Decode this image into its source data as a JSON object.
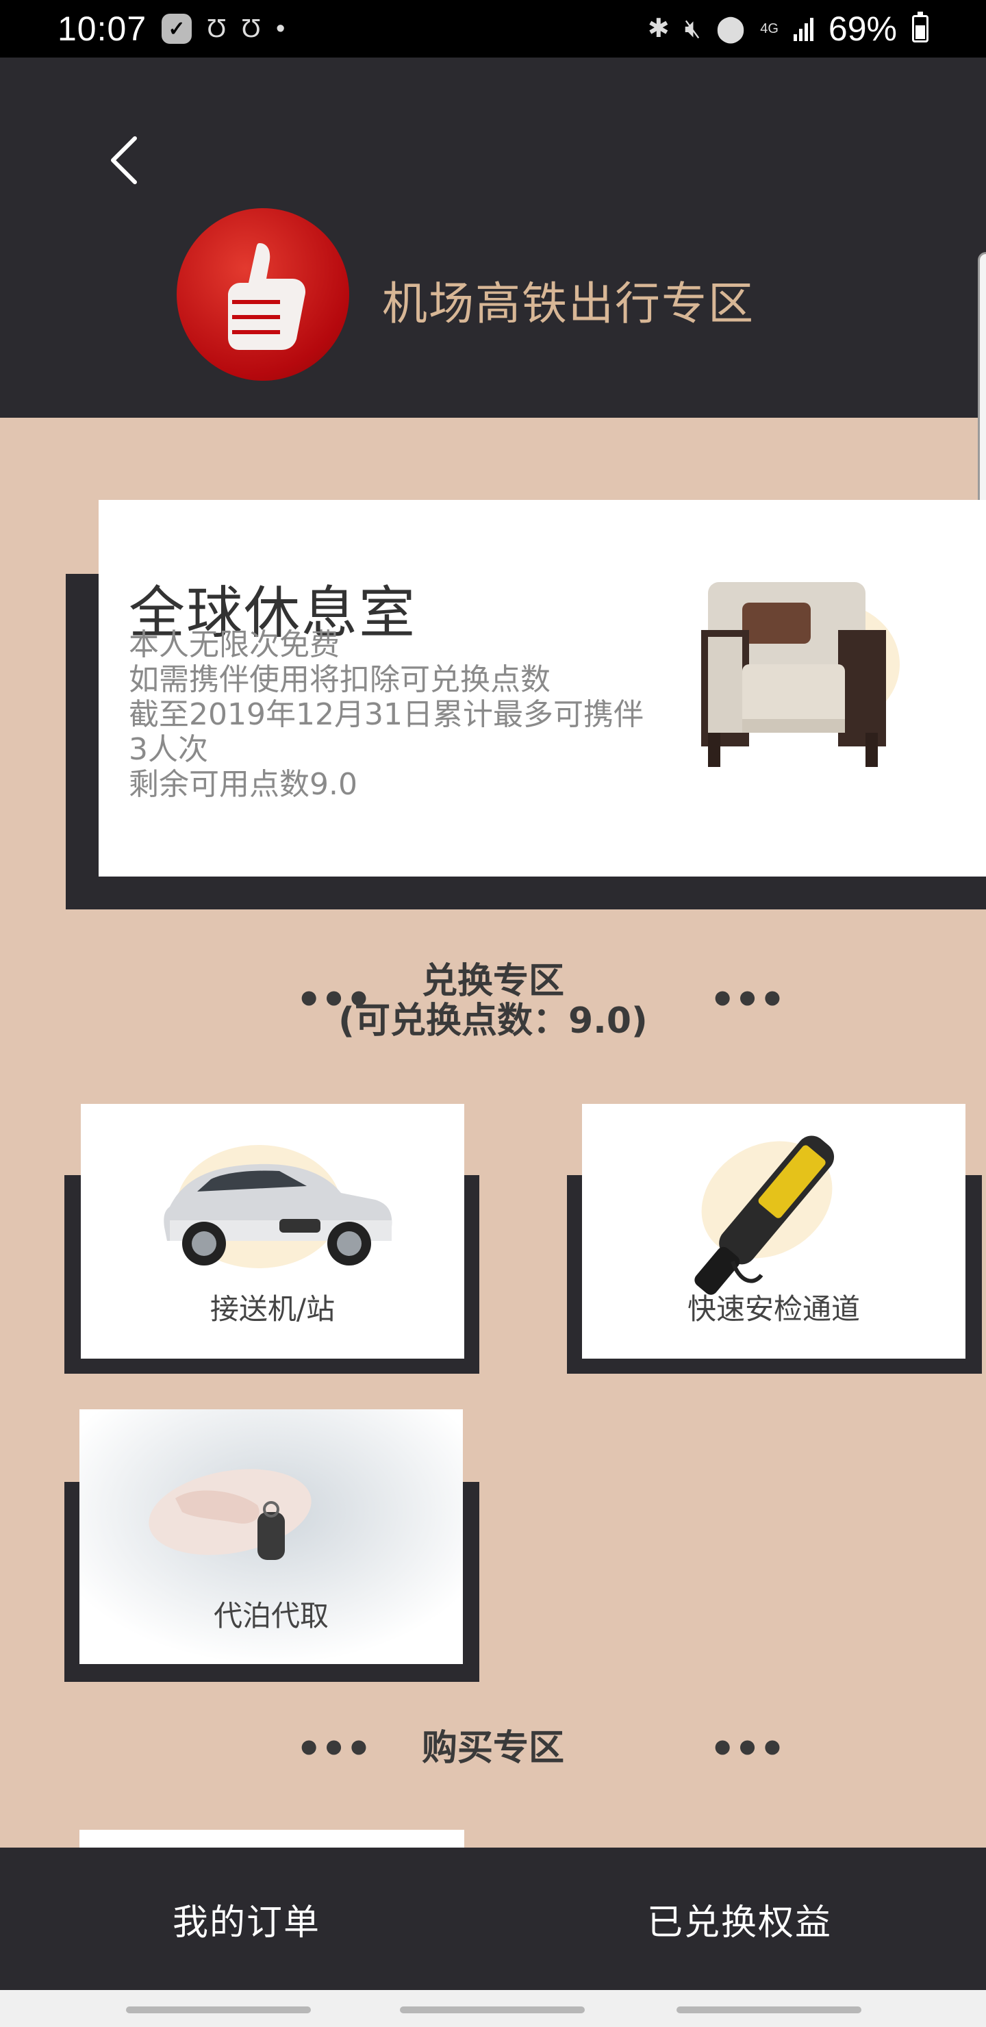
{
  "status_bar": {
    "time": "10:07",
    "battery": "69%",
    "network": "4G"
  },
  "header": {
    "title": "机场高铁出行专区"
  },
  "lounge": {
    "title": "全球休息室",
    "lines": [
      "本人无限次免费",
      "如需携伴使用将扣除可兑换点数",
      "截至2019年12月31日累计最多可携伴",
      "3人次",
      "剩余可用点数9.0"
    ]
  },
  "exchange_section": {
    "title_line1": "兑换专区",
    "title_line2": "(可兑换点数：9.0)",
    "tiles": [
      {
        "label": "接送机/站",
        "icon": "car-icon"
      },
      {
        "label": "快速安检通道",
        "icon": "metal-detector-icon"
      },
      {
        "label": "代泊代取",
        "icon": "car-key-icon"
      }
    ]
  },
  "purchase_section": {
    "title": "购买专区"
  },
  "bottom_nav": {
    "my_orders": "我的订单",
    "redeemed": "已兑换权益"
  },
  "colors": {
    "background": "#e1c5b1",
    "header": "#2b2a2f",
    "title_gold": "#d8b796",
    "logo_red": "#c4090e"
  }
}
